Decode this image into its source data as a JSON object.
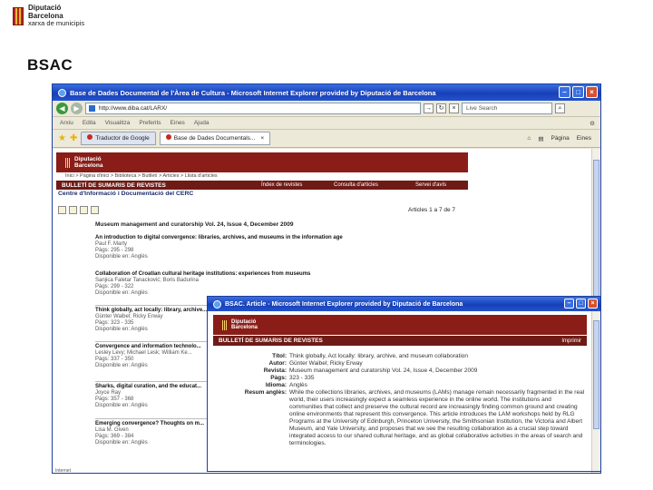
{
  "slide": {
    "logo": {
      "line1": "Diputació",
      "line2": "Barcelona",
      "line3": "xarxa de municipis"
    },
    "title": "BSAC"
  },
  "browser": {
    "title": "Base de Dades Documental de l'Àrea de Cultura - Microsoft Internet Explorer provided by Diputació de Barcelona",
    "address": "http://www.diba.cat/LARX/",
    "search_placeholder": "Live Search",
    "menu": [
      "Arxiu",
      "Edita",
      "Visualitza",
      "Preferits",
      "Eines",
      "Ajuda"
    ],
    "tabs": [
      {
        "label": "Traductor de Google"
      },
      {
        "label": "Base de Dades Documentals..."
      }
    ],
    "commands": [
      "Pàgina",
      "Eines"
    ],
    "status": "Internet"
  },
  "site": {
    "header_line1": "Diputació",
    "header_line2": "Barcelona",
    "breadcrumb": "Inici > Pàgina d'inici > Biblioteca > Butlletí > Articles > Llista d'articles",
    "bulleti": "BULLETÍ DE SUMARIS DE REVISTES",
    "nav": [
      "Índex de revistes",
      "Consulta d'articles",
      "Servei d'avís"
    ],
    "centre": "Centre d'Informació i Documentació del CERC",
    "count": "Articles 1 a 7 de 7",
    "issue": "Museum management and curatorship Vol. 24, Issue 4, December 2009"
  },
  "articles": [
    {
      "title": "An introduction to digital convergence: libraries, archives, and museums in the information age",
      "meta": "Paul F. Marty",
      "pages": "Pàgs: 295 - 298",
      "avail": "Disponible en: Anglès"
    },
    {
      "title": "Collaboration of Croatian cultural heritage institutions: experiences from museums",
      "meta": "Sanjica Faletar Tanacković; Boris Badurina",
      "pages": "Pàgs: 299 - 322",
      "avail": "Disponible en: Anglès"
    },
    {
      "title": "Think globally, act locally: library, archive...",
      "meta": "Günter Waibel; Ricky Erway",
      "pages": "Pàgs: 323 - 335",
      "avail": "Disponible en: Anglès"
    },
    {
      "title": "Convergence and information technolo...",
      "meta": "Lesley Levy; Michael Lesk; William Ke...",
      "pages": "Pàgs: 337 - 350",
      "avail": "Disponible en: Anglès"
    },
    {
      "title": "Sharks, digital curation, and the educat...",
      "meta": "Joyce Ray",
      "pages": "Pàgs: 357 - 368",
      "avail": "Disponible en: Anglès"
    },
    {
      "title": "Emerging convergence? Thoughts on m...",
      "meta": "Lisa M. Given",
      "pages": "Pàgs: 369 - 384",
      "avail": "Disponible en: Anglès"
    }
  ],
  "popup": {
    "title": "BSAC. Article - Microsoft Internet Explorer provided by Diputació de Barcelona",
    "header_line1": "Diputació",
    "header_line2": "Barcelona",
    "bar": "BULLETÍ DE SUMARIS DE REVISTES",
    "print": "Imprimir",
    "fields": [
      {
        "label": "Títol:",
        "value": "Think globally, Act locally: library, archive, and museum collaboration"
      },
      {
        "label": "Autor:",
        "value": "Günter Waibel; Ricky Erway"
      },
      {
        "label": "Revista:",
        "value": "Museum management and curatorship Vol. 24, Issue 4, December 2009"
      },
      {
        "label": "Pàgs:",
        "value": "323 - 335"
      },
      {
        "label": "Idioma:",
        "value": "Anglès"
      },
      {
        "label": "Resum anglès:",
        "value": "While the collections libraries, archives, and museums (LAMs) manage remain necessarily fragmented in the real world, their users increasingly expect a seamless experience in the online world. The institutions and communities that collect and preserve the cultural record are increasingly finding common ground and creating online environments that represent this convergence. This article introduces the LAM workshops held by RLG Programs at the University of Edinburgh, Princeton University, the Smithsonian Institution, the Victoria and Albert Museum, and Yale University, and proposes that we see the resulting collaboration as a crucial step toward integrated access to our shared cultural heritage, and as global collaborative activities in the areas of search and terminologies."
      }
    ]
  },
  "colors": {
    "brand": "#8a1d17",
    "bar": "#6e1b16",
    "titlebar": "#1740b8"
  }
}
